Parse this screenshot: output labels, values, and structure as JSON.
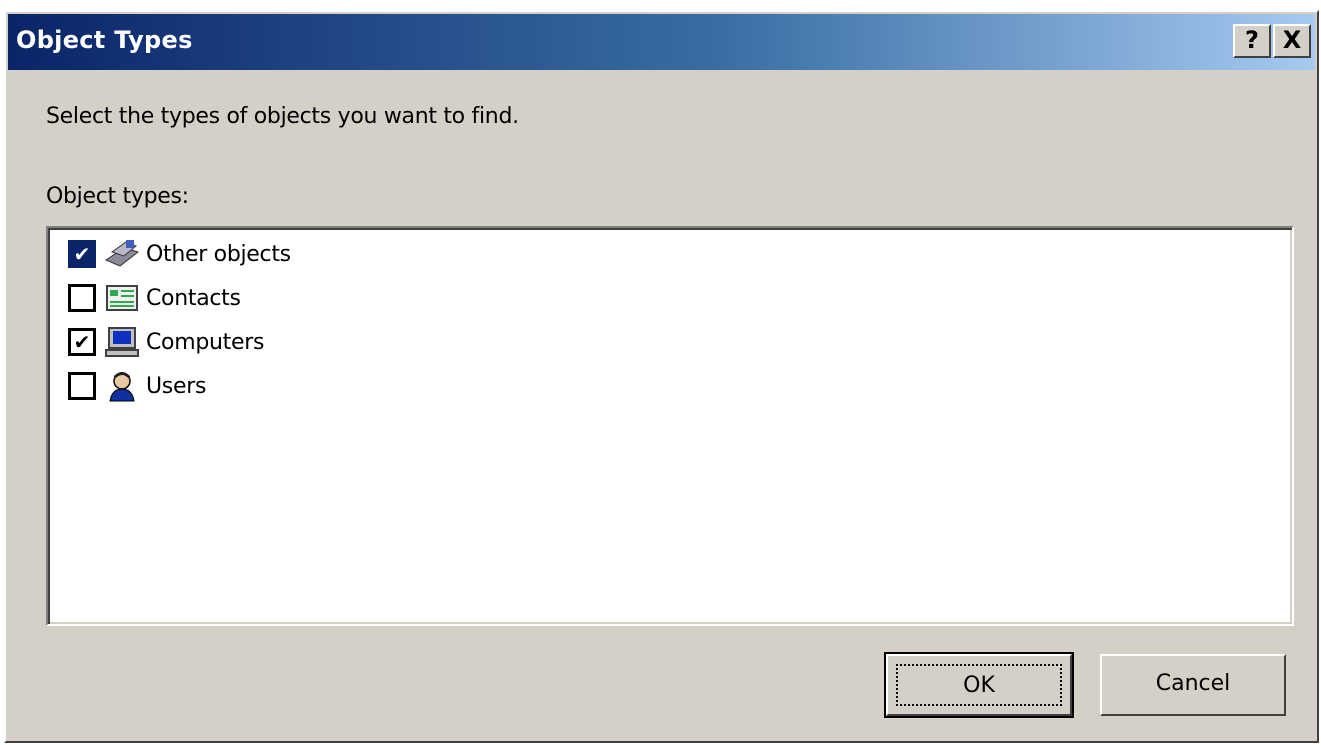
{
  "dialog": {
    "title": "Object Types",
    "help_glyph": "?",
    "close_glyph": "X",
    "prompt": "Select the types of objects you want to find.",
    "list_label": "Object types:",
    "items": [
      {
        "label": "Other objects",
        "checked": true,
        "icon": "other-objects-icon"
      },
      {
        "label": "Contacts",
        "checked": false,
        "icon": "contacts-icon"
      },
      {
        "label": "Computers",
        "checked": true,
        "icon": "computer-icon"
      },
      {
        "label": "Users",
        "checked": false,
        "icon": "user-icon"
      }
    ],
    "check_glyph": "✔",
    "ok_label": "OK",
    "cancel_label": "Cancel"
  },
  "colors": {
    "titlebar_start": "#0a246a",
    "titlebar_end": "#a6caf0",
    "dialog_face": "#d4d0c8"
  }
}
